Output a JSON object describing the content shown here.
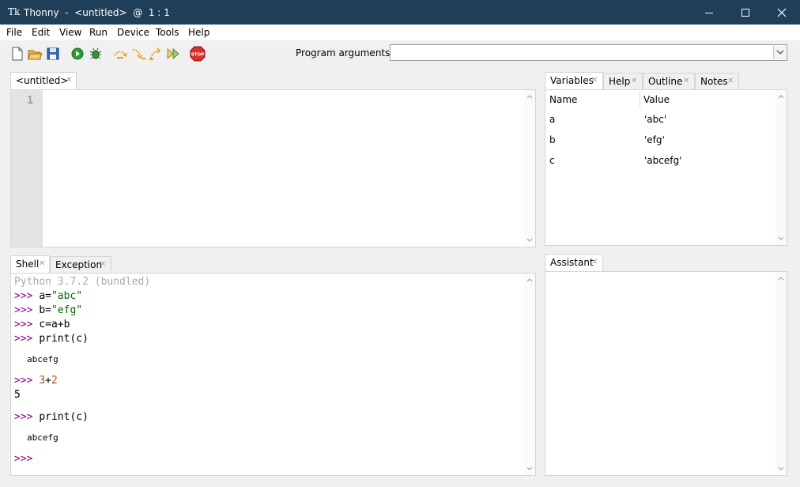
{
  "window": {
    "app_icon": "Tk",
    "title": "Thonny  -  <untitled>  @  1 : 1"
  },
  "menu": [
    "File",
    "Edit",
    "View",
    "Run",
    "Device",
    "Tools",
    "Help"
  ],
  "toolbar": {
    "program_arguments_label": "Program arguments:",
    "program_arguments_value": ""
  },
  "editor": {
    "tab_label": "<untitled>",
    "line_numbers": [
      "1"
    ]
  },
  "variables_panel": {
    "tabs": [
      "Variables",
      "Help",
      "Outline",
      "Notes"
    ],
    "columns": [
      "Name",
      "Value"
    ],
    "rows": [
      {
        "name": "a",
        "value": "'abc'"
      },
      {
        "name": "b",
        "value": "'efg'"
      },
      {
        "name": "c",
        "value": "'abcefg'"
      }
    ]
  },
  "shell_panel": {
    "tabs": [
      "Shell",
      "Exception"
    ],
    "banner": "Python 3.7.2 (bundled)",
    "prompt": ">>>",
    "lines": {
      "l1_code": "a=",
      "l1_str": "\"abc\"",
      "l2_code": "b=",
      "l2_str": "\"efg\"",
      "l3_code": "c=a+b",
      "l4_code": "print(c)",
      "out1": "abcefg",
      "l5_a": "3",
      "l5_op": "+",
      "l5_b": "2",
      "out2": "5",
      "l6_code": "print(c)",
      "out3": "abcefg"
    }
  },
  "assistant_panel": {
    "tabs": [
      "Assistant"
    ]
  },
  "colors": {
    "titlebar": "#1e3f57",
    "prompt": "#8b008b",
    "string": "#006400",
    "number": "#a0522d"
  }
}
